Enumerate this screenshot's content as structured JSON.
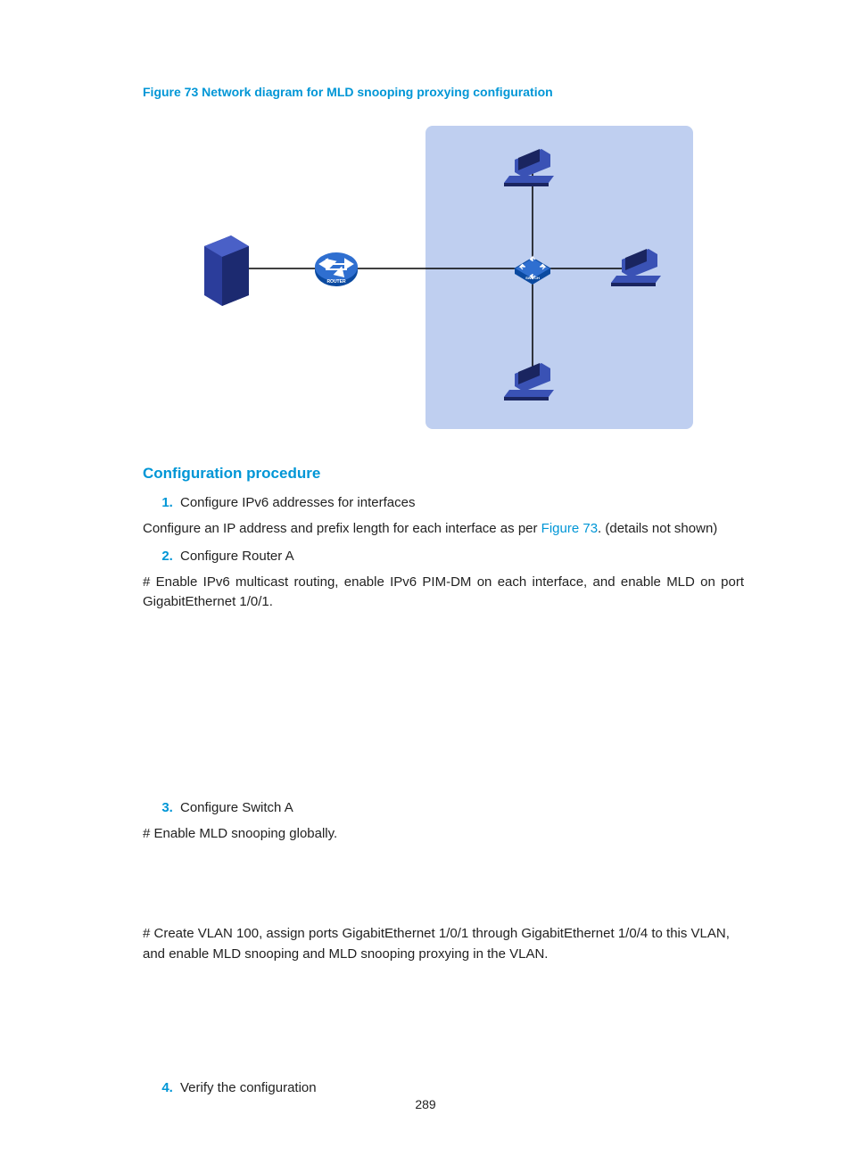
{
  "figure_caption": "Figure 73 Network diagram for MLD snooping proxying configuration",
  "section_heading": "Configuration procedure",
  "steps": {
    "s1": "Configure IPv6 addresses for interfaces",
    "s2": "Configure Router A",
    "s3": "Configure Switch A",
    "s4": "Verify the configuration"
  },
  "paragraphs": {
    "p1_pre": "Configure an IP address and prefix length for each interface as per ",
    "p1_link": "Figure 73",
    "p1_post": ". (details not shown)",
    "p2": "# Enable IPv6 multicast routing, enable IPv6 PIM-DM on each interface, and enable MLD on port GigabitEthernet 1/0/1.",
    "p3": "# Enable MLD snooping globally.",
    "p4": "# Create VLAN 100, assign ports GigabitEthernet 1/0/1 through GigabitEthernet 1/0/4 to this VLAN, and enable MLD snooping and MLD snooping proxying in the VLAN."
  },
  "page_number": "289",
  "diagram": {
    "nodes": {
      "server": "server-icon",
      "router": "router-icon",
      "switch": "switch-icon",
      "host_top": "computer-icon",
      "host_right": "computer-icon",
      "host_bottom": "computer-icon"
    },
    "router_label": "ROUTER",
    "switch_label": "SWITCH"
  }
}
